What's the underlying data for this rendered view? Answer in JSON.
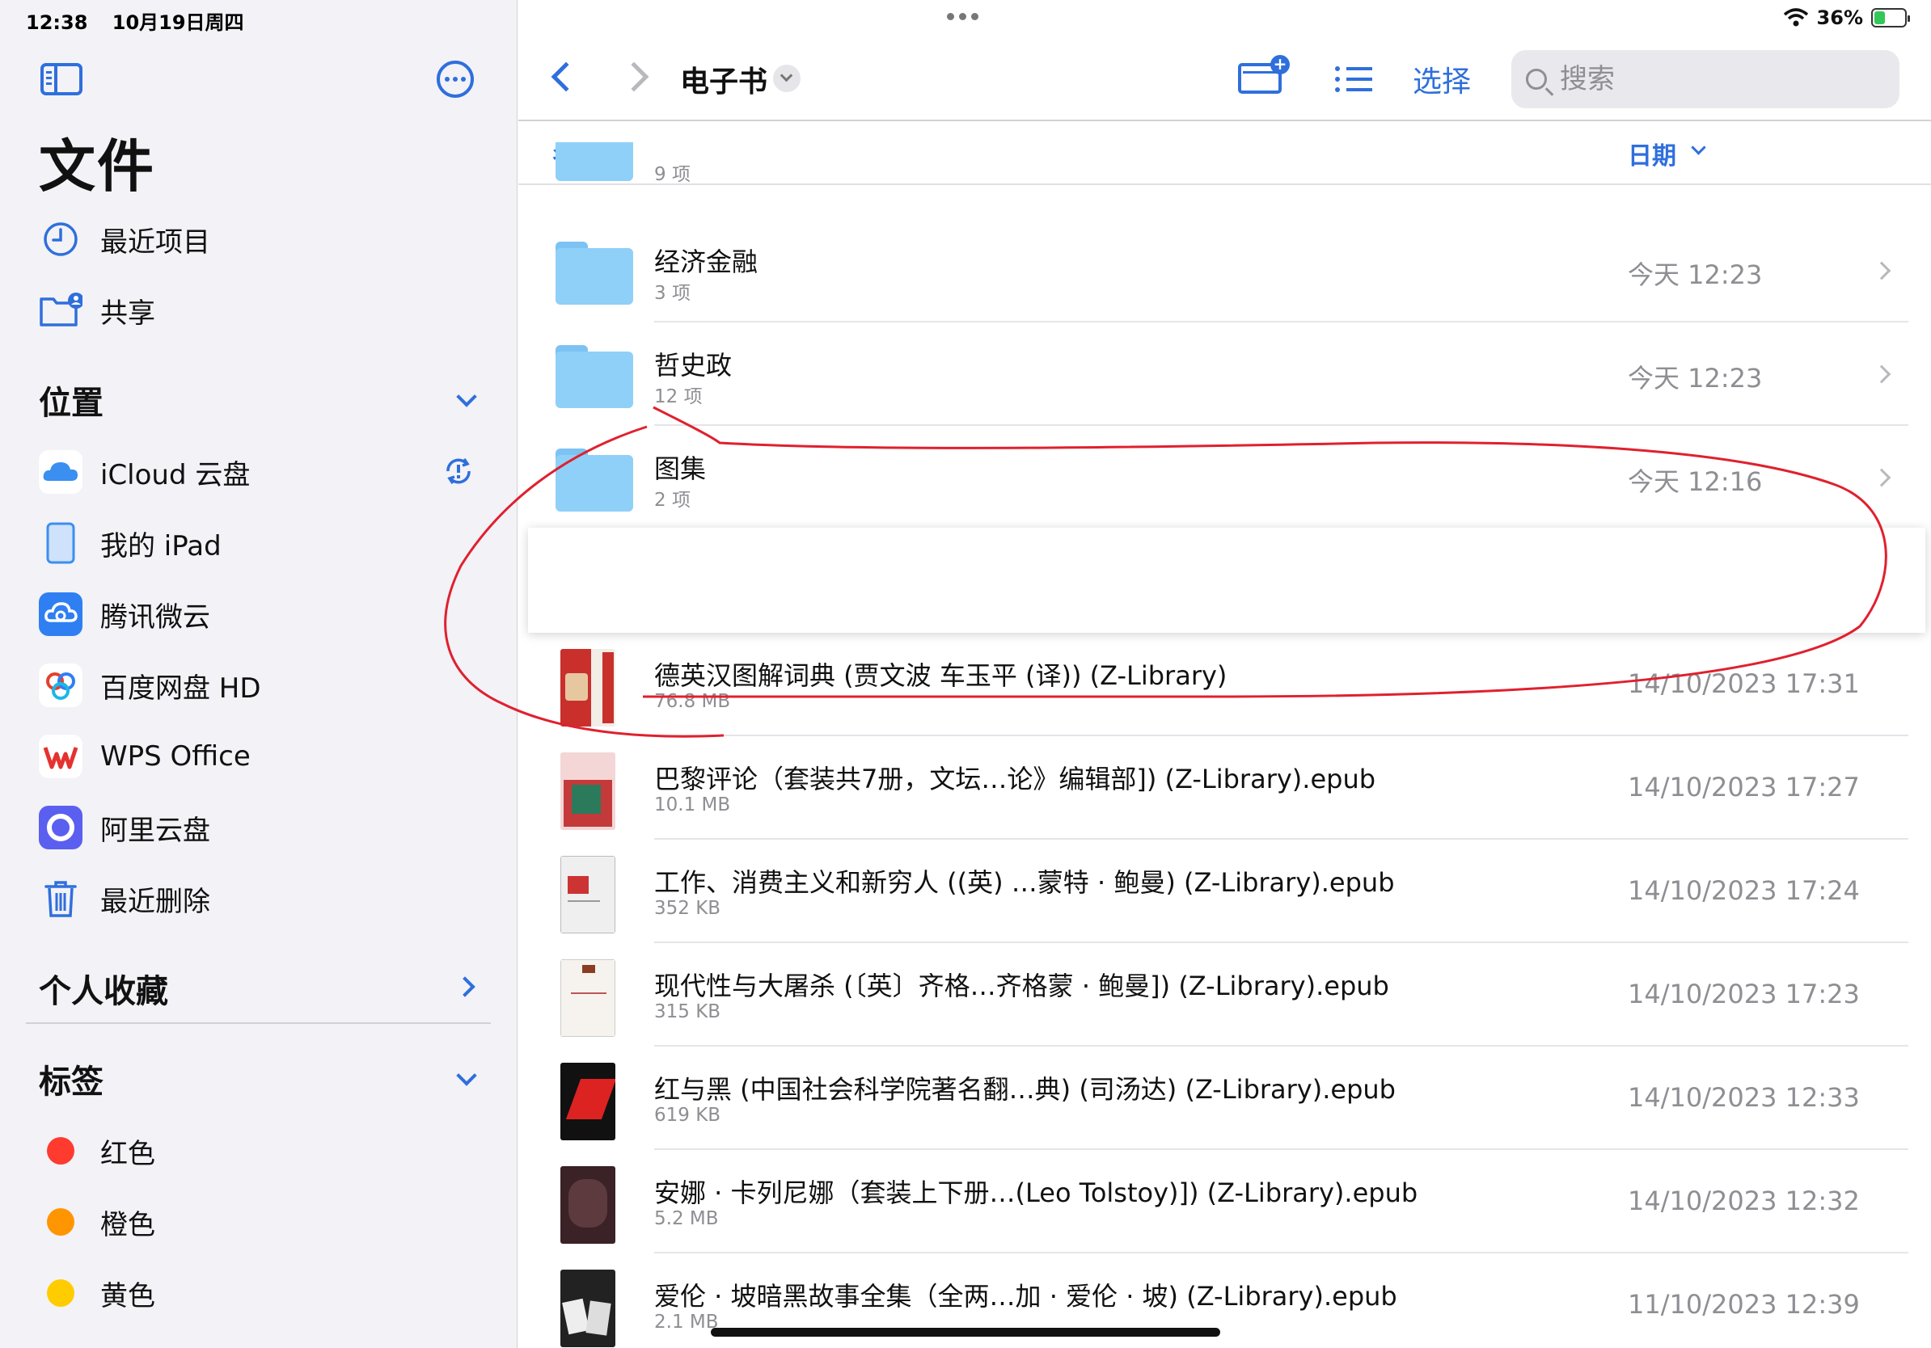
{
  "status": {
    "time": "12:38",
    "date": "10月19日周四",
    "battery": "36%",
    "battery_level": 0.36
  },
  "sidebar": {
    "title": "文件",
    "top_items": [
      {
        "label": "最近项目",
        "icon": "clock-icon"
      },
      {
        "label": "共享",
        "icon": "shared-folder-icon"
      }
    ],
    "locations_title": "位置",
    "locations": [
      {
        "label": "iCloud 云盘",
        "icon": "icloud-icon"
      },
      {
        "label": "我的 iPad",
        "icon": "ipad-icon"
      },
      {
        "label": "腾讯微云",
        "icon": "weiyun-icon"
      },
      {
        "label": "百度网盘 HD",
        "icon": "baidu-netdisk-icon"
      },
      {
        "label": "WPS Office",
        "icon": "wps-icon"
      },
      {
        "label": "阿里云盘",
        "icon": "aliyun-drive-icon"
      },
      {
        "label": "最近删除",
        "icon": "trash-icon"
      }
    ],
    "favorites_title": "个人收藏",
    "tags_title": "标签",
    "tags": [
      {
        "label": "红色",
        "color": "#ff3b30"
      },
      {
        "label": "橙色",
        "color": "#ff9500"
      },
      {
        "label": "黄色",
        "color": "#ffcc00"
      }
    ]
  },
  "toolbar": {
    "folder_title": "电子书",
    "select_label": "选择",
    "search_placeholder": "搜索"
  },
  "columns": {
    "name": "名称",
    "date": "日期"
  },
  "partial_row": {
    "sub": "9 项"
  },
  "files": [
    {
      "name": "经济金融",
      "sub": "3 项",
      "date": "今天 12:23",
      "kind": "folder"
    },
    {
      "name": "哲史政",
      "sub": "12 项",
      "date": "今天 12:23",
      "kind": "folder"
    },
    {
      "name": "图集",
      "sub": "2 项",
      "date": "今天 12:16",
      "kind": "folder"
    },
    {
      "name": "德英汉图解词典 (贾文波 车玉平 (译)) (Z-Library)",
      "sub": "76.8 MB",
      "date": "14/10/2023 17:31",
      "kind": "book"
    },
    {
      "name": "巴黎评论（套装共7册，文坛…论》编辑部]) (Z-Library).epub",
      "sub": "10.1 MB",
      "date": "14/10/2023 17:27",
      "kind": "book"
    },
    {
      "name": "工作、消费主义和新穷人 ((英) …蒙特 · 鲍曼) (Z-Library).epub",
      "sub": "352 KB",
      "date": "14/10/2023 17:24",
      "kind": "book"
    },
    {
      "name": "现代性与大屠杀 (〔英〕齐格…齐格蒙 · 鲍曼]) (Z-Library).epub",
      "sub": "315 KB",
      "date": "14/10/2023 17:23",
      "kind": "book"
    },
    {
      "name": "红与黑 (中国社会科学院著名翻…典) (司汤达) (Z-Library).epub",
      "sub": "619 KB",
      "date": "14/10/2023 12:33",
      "kind": "book"
    },
    {
      "name": "安娜 · 卡列尼娜（套装上下册…(Leo Tolstoy)]) (Z-Library).epub",
      "sub": "5.2 MB",
      "date": "14/10/2023 12:32",
      "kind": "book"
    },
    {
      "name": "爱伦 · 坡暗黑故事全集（全两…加 · 爱伦 · 坡) (Z-Library).epub",
      "sub": "2.1 MB",
      "date": "11/10/2023 12:39",
      "kind": "book"
    }
  ],
  "annotation_color": "#e0202e"
}
